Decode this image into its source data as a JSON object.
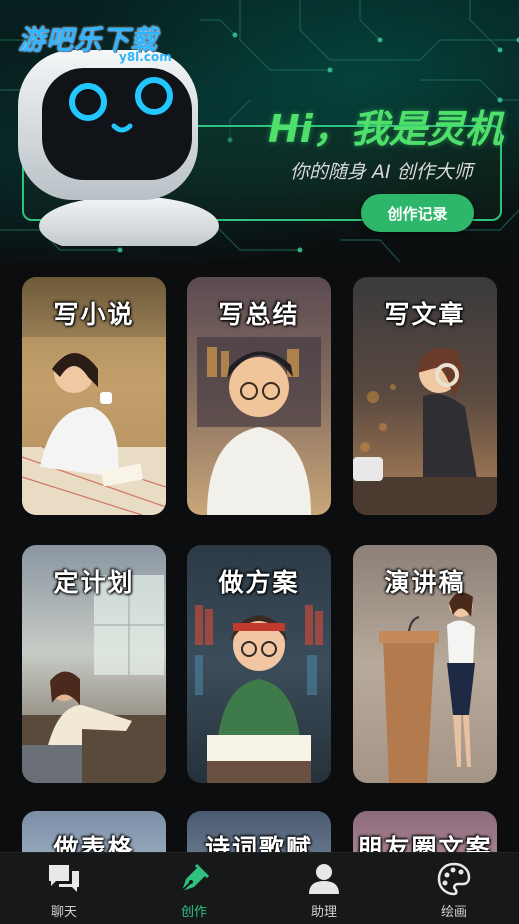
{
  "watermark": {
    "text": "游吧乐下载",
    "sub": "y8l.com"
  },
  "header": {
    "title": "Hi，我是灵机",
    "subtitle": "你的随身 AI 创作大师",
    "records_button": "创作记录"
  },
  "cards": [
    {
      "label": "写小说"
    },
    {
      "label": "写总结"
    },
    {
      "label": "写文章"
    },
    {
      "label": "定计划"
    },
    {
      "label": "做方案"
    },
    {
      "label": "演讲稿"
    },
    {
      "label": "做表格"
    },
    {
      "label": "诗词歌赋"
    },
    {
      "label": "朋友圈文案"
    }
  ],
  "tabbar": {
    "items": [
      {
        "label": "聊天",
        "icon": "chat-icon"
      },
      {
        "label": "创作",
        "icon": "pen-icon"
      },
      {
        "label": "助理",
        "icon": "person-icon"
      },
      {
        "label": "绘画",
        "icon": "palette-icon"
      }
    ],
    "active_index": 1,
    "active_color": "#2ec27e"
  },
  "colors": {
    "accent": "#2ec27e",
    "hero_title": "#4ee06b",
    "watermark": "#2fb5ff"
  }
}
